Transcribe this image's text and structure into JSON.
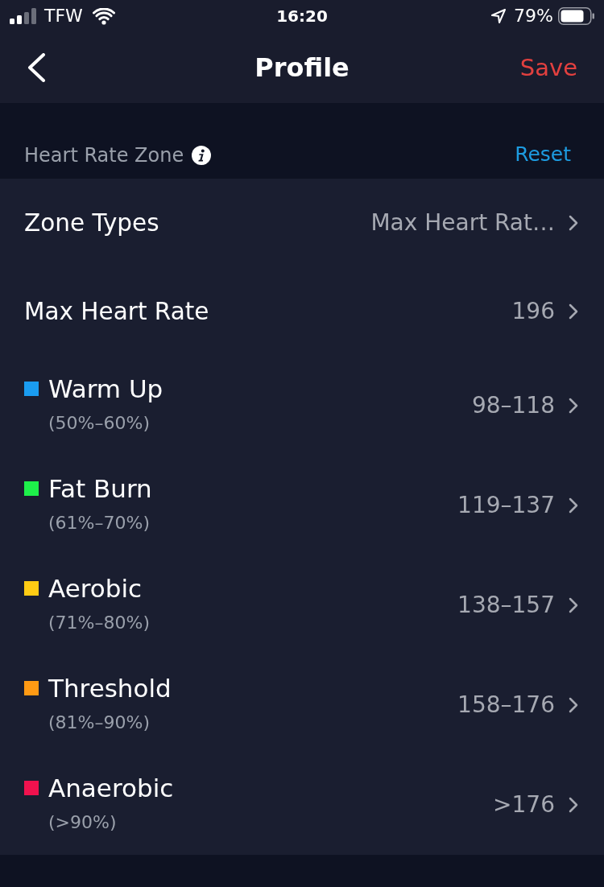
{
  "status_bar": {
    "carrier": "TFW",
    "time": "16:20",
    "battery": "79%"
  },
  "nav_bar": {
    "title": "Profile",
    "action": "Save"
  },
  "section": {
    "title": "Heart Rate Zone",
    "action": "Reset"
  },
  "rows": [
    {
      "kind": "setting",
      "label": "Zone Types",
      "value": "Max Heart Rat…"
    },
    {
      "kind": "setting",
      "label": "Max Heart Rate",
      "value": "196"
    },
    {
      "kind": "zone",
      "label": "Warm Up",
      "range": "(50%–60%)",
      "value": "98–118",
      "color": "#1a9cf0"
    },
    {
      "kind": "zone",
      "label": "Fat Burn",
      "range": "(61%–70%)",
      "value": "119–137",
      "color": "#1ef04a"
    },
    {
      "kind": "zone",
      "label": "Aerobic",
      "range": "(71%–80%)",
      "value": "138–157",
      "color": "#ffcc14"
    },
    {
      "kind": "zone",
      "label": "Threshold",
      "range": "(81%–90%)",
      "value": "158–176",
      "color": "#ff9a14"
    },
    {
      "kind": "zone",
      "label": "Anaerobic",
      "range": "(>90%)",
      "value": ">176",
      "color": "#f0124e"
    }
  ]
}
